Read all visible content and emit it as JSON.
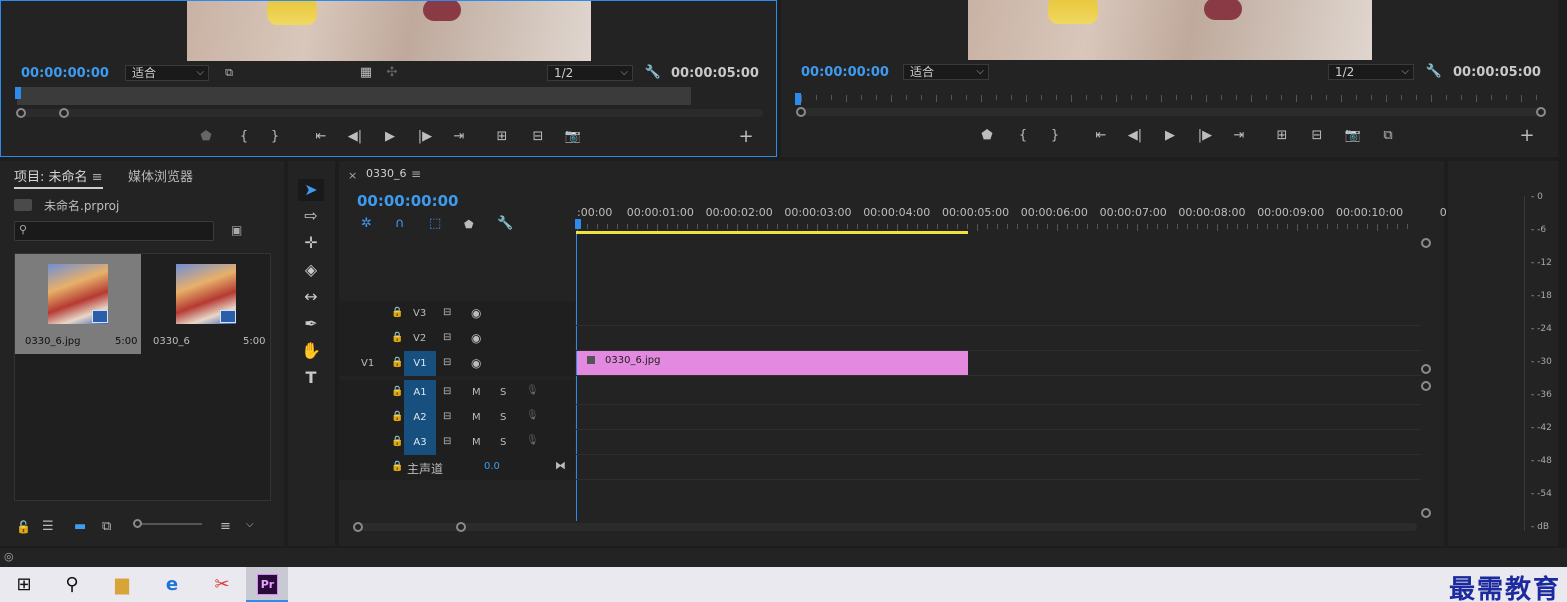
{
  "source_monitor": {
    "timecode_current": "00:00:00:00",
    "fit": "适合",
    "resolution": "1/2",
    "timecode_duration": "00:00:05:00"
  },
  "program_monitor": {
    "timecode_current": "00:00:00:00",
    "fit": "适合",
    "resolution": "1/2",
    "timecode_duration": "00:00:05:00"
  },
  "project": {
    "tab_project": "项目: 未命名",
    "tab_media_browser": "媒体浏览器",
    "project_file": "未命名.prproj",
    "search_placeholder": "",
    "items": [
      {
        "name": "0330_6.jpg",
        "duration": "5:00"
      },
      {
        "name": "0330_6",
        "duration": "5:00"
      }
    ]
  },
  "timeline": {
    "sequence_name": "0330_6",
    "timecode": "00:00:00:00",
    "ruler": [
      ":00:00",
      "00:00:01:00",
      "00:00:02:00",
      "00:00:03:00",
      "00:00:04:00",
      "00:00:05:00",
      "00:00:06:00",
      "00:00:07:00",
      "00:00:08:00",
      "00:00:09:00",
      "00:00:10:00",
      "0"
    ],
    "video_tracks": [
      "V3",
      "V2",
      "V1"
    ],
    "source_patch": "V1",
    "audio_tracks": [
      "A1",
      "A2",
      "A3"
    ],
    "mute_label": "M",
    "solo_label": "S",
    "master_label": "主声道",
    "master_value": "0.0",
    "clip_name": "0330_6.jpg"
  },
  "audio_meter": {
    "scale": [
      "0",
      "-6",
      "-12",
      "-18",
      "-24",
      "-30",
      "-36",
      "-42",
      "-48",
      "-54",
      "dB"
    ]
  },
  "taskbar": {
    "premiere_label": "Pr"
  },
  "watermark": "最需教育",
  "colors": {
    "accent_blue": "#3d9bf0",
    "track_target": "#17507e",
    "clip_pink": "#e38ae0",
    "playhead": "#2d8ceb",
    "workarea_yellow": "#f0e23a"
  }
}
